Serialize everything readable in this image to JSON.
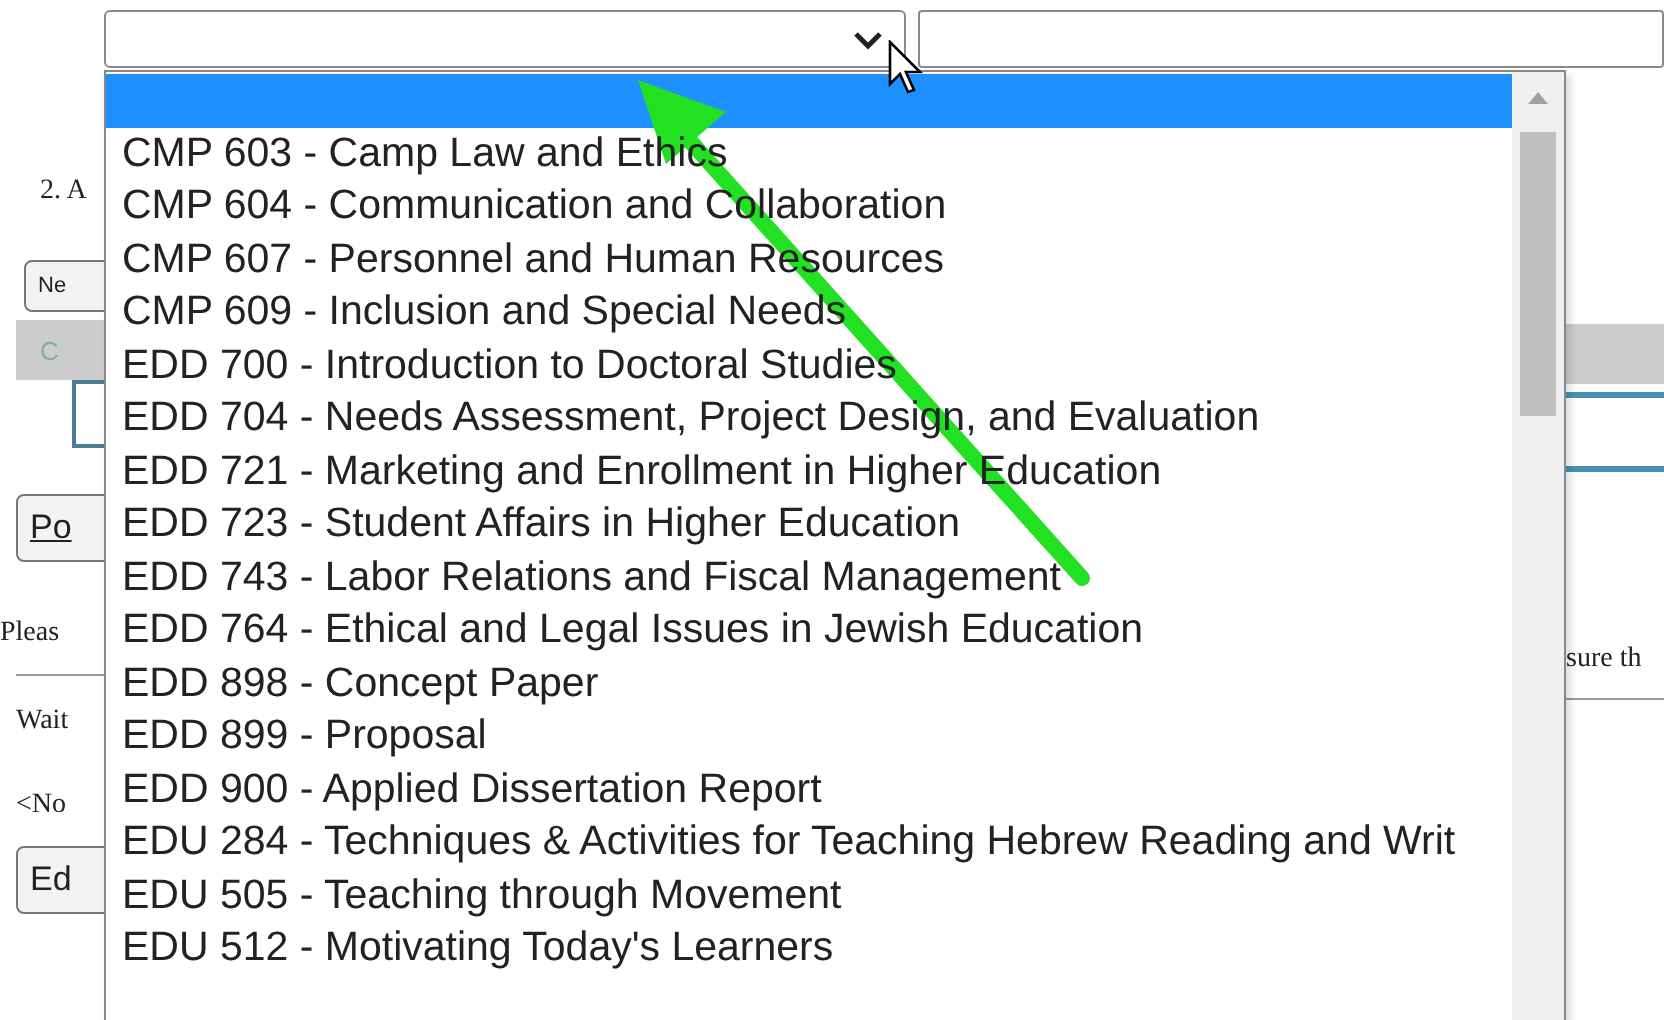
{
  "course_select": {
    "expanded": true
  },
  "dropdown": {
    "options": [
      {
        "selected": true
      },
      {
        "label": "CMP 603 - Camp Law and Ethics",
        "selected": false
      },
      {
        "label": "CMP 604 - Communication and Collaboration",
        "selected": false
      },
      {
        "label": "CMP 607 - Personnel and Human Resources",
        "selected": false
      },
      {
        "label": "CMP 609 - Inclusion and Special Needs",
        "selected": false
      },
      {
        "label": "EDD 700 - Introduction to Doctoral Studies",
        "selected": false
      },
      {
        "label": "EDD 704 - Needs Assessment, Project Design, and Evaluation",
        "selected": false
      },
      {
        "label": "EDD 721 - Marketing and Enrollment in Higher Education",
        "selected": false
      },
      {
        "label": "EDD 723 - Student Affairs in Higher Education",
        "selected": false
      },
      {
        "label": "EDD 743 - Labor Relations and Fiscal Management",
        "selected": false
      },
      {
        "label": "EDD 764 - Ethical and Legal Issues in Jewish Education",
        "selected": false
      },
      {
        "label": "EDD 898 - Concept Paper",
        "selected": false
      },
      {
        "label": "EDD 899 - Proposal",
        "selected": false
      },
      {
        "label": "EDD 900 - Applied Dissertation Report",
        "selected": false
      },
      {
        "label": "EDU 284 - Techniques & Activities for Teaching Hebrew Reading and Writ",
        "selected": false
      },
      {
        "label": "EDU 505 - Teaching through Movement",
        "selected": false
      },
      {
        "label": "EDU 512 - Motivating Today's Learners",
        "selected": false
      }
    ]
  },
  "page_behind": {
    "step_text": "2. A",
    "new_button": "Ne",
    "table_header": "C",
    "post_button": "Po",
    "notice": "Pleas",
    "notice_right": "sure th",
    "waiting_text": "Wait",
    "no_items_text": "<No",
    "edit_button": "Ed"
  },
  "annotation": {
    "kind": "arrow"
  }
}
